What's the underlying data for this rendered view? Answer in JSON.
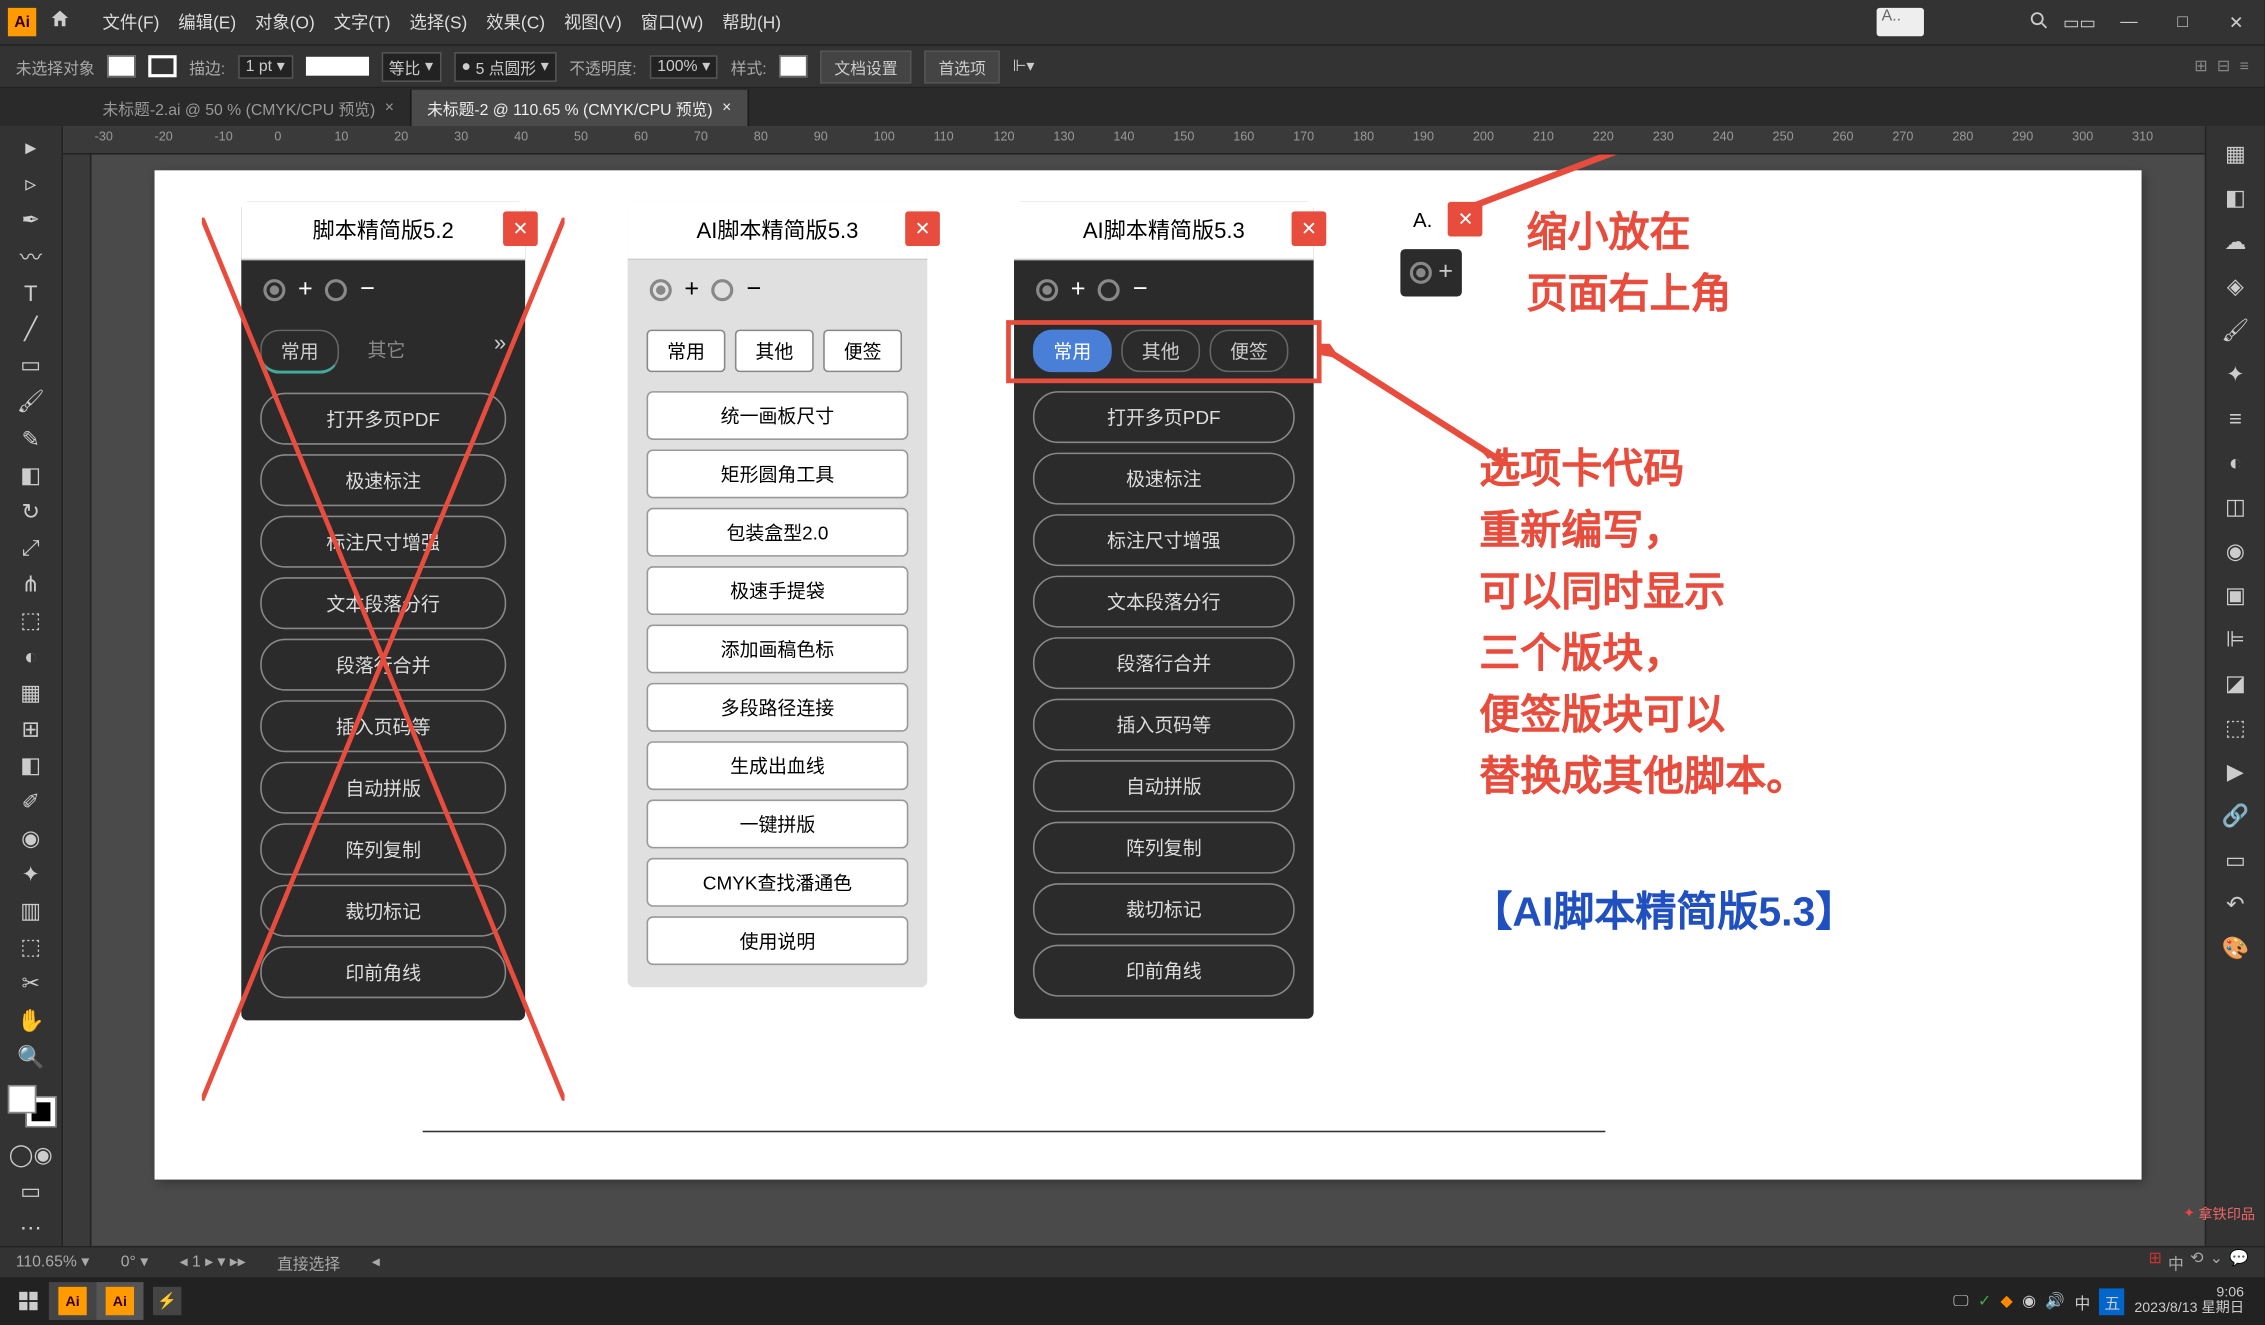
{
  "app": {
    "logo": "Ai"
  },
  "menus": [
    "文件(F)",
    "编辑(E)",
    "对象(O)",
    "文字(T)",
    "选择(S)",
    "效果(C)",
    "视图(V)",
    "窗口(W)",
    "帮助(H)"
  ],
  "search_placeholder": "A..",
  "options": {
    "no_selection": "未选择对象",
    "stroke_label": "描边:",
    "stroke_val": "1 pt",
    "uniform": "等比",
    "profile": "5 点圆形",
    "opacity_label": "不透明度:",
    "opacity_val": "100%",
    "style_label": "样式:",
    "doc_setup": "文档设置",
    "prefs": "首选项"
  },
  "tabs": [
    {
      "label": "未标题-2.ai @ 50 % (CMYK/CPU 预览)",
      "active": false
    },
    {
      "label": "未标题-2 @ 110.65 % (CMYK/CPU 预览)",
      "active": true
    }
  ],
  "ruler_marks": [
    -30,
    -20,
    -10,
    0,
    10,
    20,
    30,
    40,
    50,
    60,
    70,
    80,
    90,
    100,
    110,
    120,
    130,
    140,
    150,
    160,
    170,
    180,
    190,
    200,
    210,
    220,
    230,
    240,
    250,
    260,
    270,
    280,
    290,
    300,
    310
  ],
  "panel1": {
    "title": "脚本精简版5.2",
    "tabs": [
      "常用",
      "其它"
    ],
    "buttons": [
      "打开多页PDF",
      "极速标注",
      "标注尺寸增强",
      "文本段落分行",
      "段落行合并",
      "插入页码等",
      "自动拼版",
      "阵列复制",
      "裁切标记",
      "印前角线"
    ]
  },
  "panel2": {
    "title": "AI脚本精简版5.3",
    "tabs": [
      "常用",
      "其他",
      "便签"
    ],
    "buttons": [
      "统一画板尺寸",
      "矩形圆角工具",
      "包装盒型2.0",
      "极速手提袋",
      "添加画稿色标",
      "多段路径连接",
      "生成出血线",
      "一键拼版",
      "CMYK查找潘通色",
      "使用说明"
    ]
  },
  "panel3": {
    "title": "AI脚本精简版5.3",
    "tabs": [
      "常用",
      "其他",
      "便签"
    ],
    "buttons": [
      "打开多页PDF",
      "极速标注",
      "标注尺寸增强",
      "文本段落分行",
      "段落行合并",
      "插入页码等",
      "自动拼版",
      "阵列复制",
      "裁切标记",
      "印前角线"
    ]
  },
  "mini_panel": {
    "title": "A."
  },
  "annotations": {
    "top": "缩小放在\n页面右上角",
    "mid": "选项卡代码\n重新编写，\n可以同时显示\n三个版块，\n便签版块可以\n替换成其他脚本。",
    "bottom": "【AI脚本精简版5.3】"
  },
  "status": {
    "zoom": "110.65%",
    "angle": "0°",
    "tool": "直接选择"
  },
  "taskbar": {
    "tray": [
      "五",
      "中",
      "▲",
      "⟲"
    ],
    "time": "9:06",
    "date": "2023/8/13 星期日"
  },
  "watermark": "拿铁印品"
}
